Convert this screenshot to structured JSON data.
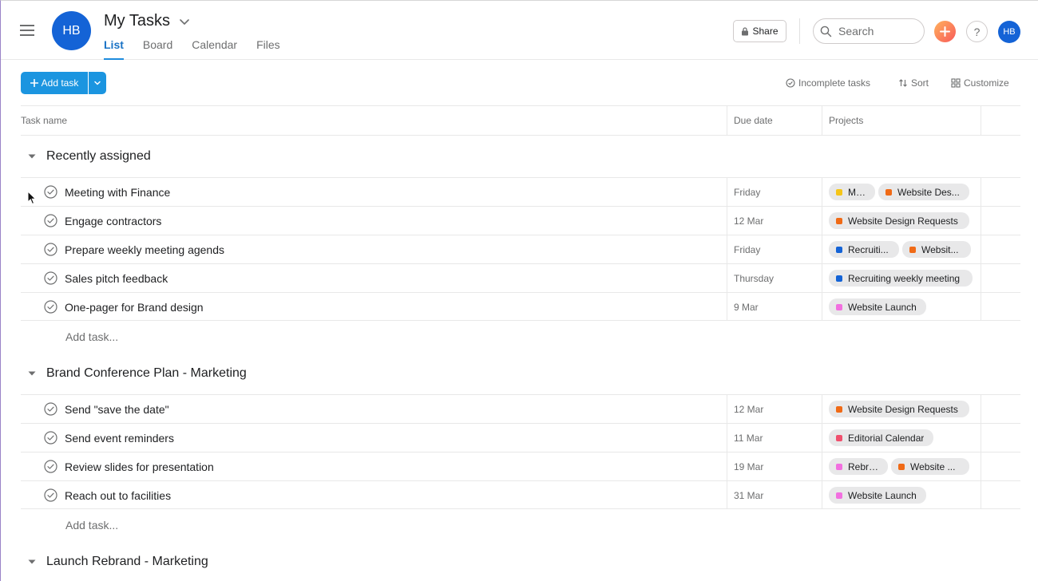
{
  "header": {
    "avatar_initials": "HB",
    "title": "My Tasks",
    "tabs": [
      {
        "label": "List",
        "active": true
      },
      {
        "label": "Board",
        "active": false
      },
      {
        "label": "Calendar",
        "active": false
      },
      {
        "label": "Files",
        "active": false
      }
    ],
    "share_label": "Share",
    "search_placeholder": "Search",
    "help_label": "?",
    "user_initials": "HB"
  },
  "toolbar": {
    "add_task_label": "Add task",
    "incomplete_label": "Incomplete tasks",
    "sort_label": "Sort",
    "customize_label": "Customize"
  },
  "columns": {
    "task_name": "Task name",
    "due_date": "Due date",
    "projects": "Projects"
  },
  "colors": {
    "accent": "#1b95e0",
    "yellow": "#f5c518",
    "orange": "#f06a16",
    "blue": "#1463d6",
    "pink": "#f26fe0",
    "red": "#f0506e"
  },
  "sections": [
    {
      "label": "Recently assigned",
      "add_label": "Add task...",
      "tasks": [
        {
          "name": "Meeting with Finance",
          "due": "Friday",
          "projects": [
            {
              "label": "Ma...",
              "color": "#f5c518",
              "w": 58
            },
            {
              "label": "Website Des...",
              "color": "#f06a16",
              "w": 114
            }
          ]
        },
        {
          "name": "Engage contractors",
          "due": "12 Mar",
          "projects": [
            {
              "label": "Website Design Requests",
              "color": "#f06a16",
              "w": 176
            }
          ]
        },
        {
          "name": "Prepare weekly meeting agends",
          "due": "Friday",
          "projects": [
            {
              "label": "Recruiti...",
              "color": "#1463d6",
              "w": 88
            },
            {
              "label": "Websit...",
              "color": "#f06a16",
              "w": 86
            }
          ]
        },
        {
          "name": "Sales pitch feedback",
          "due": "Thursday",
          "projects": [
            {
              "label": "Recruiting weekly meeting",
              "color": "#1463d6",
              "w": 180
            }
          ]
        },
        {
          "name": "One-pager for Brand design",
          "due": "9 Mar",
          "projects": [
            {
              "label": "Website Launch",
              "color": "#f26fe0",
              "w": 122
            }
          ]
        }
      ]
    },
    {
      "label": "Brand Conference Plan - Marketing",
      "add_label": "Add task...",
      "tasks": [
        {
          "name": "Send \"save the date\"",
          "due": "12 Mar",
          "projects": [
            {
              "label": "Website Design Requests",
              "color": "#f06a16",
              "w": 176
            }
          ]
        },
        {
          "name": "Send event reminders",
          "due": "11 Mar",
          "projects": [
            {
              "label": "Editorial Calendar",
              "color": "#f0506e",
              "w": 131
            }
          ]
        },
        {
          "name": "Review slides for presentation",
          "due": "19 Mar",
          "projects": [
            {
              "label": "Rebra...",
              "color": "#f26fe0",
              "w": 74
            },
            {
              "label": "Website ...",
              "color": "#f06a16",
              "w": 98
            }
          ]
        },
        {
          "name": "Reach out to facilities",
          "due": "31 Mar",
          "projects": [
            {
              "label": "Website Launch",
              "color": "#f26fe0",
              "w": 122
            }
          ]
        }
      ]
    },
    {
      "label": "Launch Rebrand - Marketing",
      "tasks": []
    }
  ]
}
